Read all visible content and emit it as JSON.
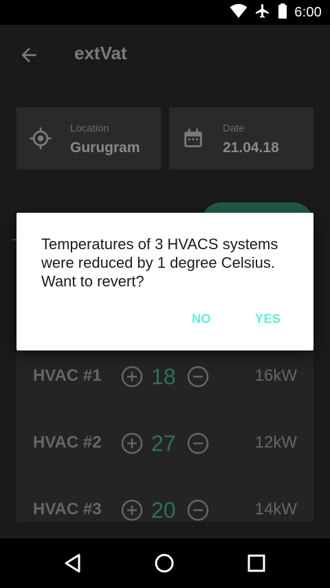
{
  "status_bar": {
    "time": "6:00",
    "icons": [
      "wifi-icon",
      "airplane-icon",
      "battery-icon"
    ]
  },
  "toolbar": {
    "title": "extVat",
    "back_icon": "arrow-back-icon"
  },
  "location_card": {
    "label": "Location",
    "value": "Gurugram",
    "icon": "gps-target-icon"
  },
  "date_card": {
    "label": "Date",
    "value": "21.04.18",
    "icon": "calendar-icon"
  },
  "hvacs": [
    {
      "name": "HVAC #1",
      "temp": "18",
      "power": "16kW"
    },
    {
      "name": "HVAC #2",
      "temp": "27",
      "power": "12kW"
    },
    {
      "name": "HVAC #3",
      "temp": "20",
      "power": "14kW"
    }
  ],
  "dialog": {
    "message": "Temperatures of 3 HVACS systems were reduced by 1 degree Celsius. Want to revert?",
    "no_label": "NO",
    "yes_label": "YES"
  },
  "colors": {
    "accent": "#5ff0d6",
    "background": "#1a1a1a",
    "card": "#2a2a2a",
    "temp": "#2f6f60"
  },
  "nav_bar": {
    "icons": [
      "back-triangle-icon",
      "home-circle-icon",
      "recents-square-icon"
    ]
  }
}
